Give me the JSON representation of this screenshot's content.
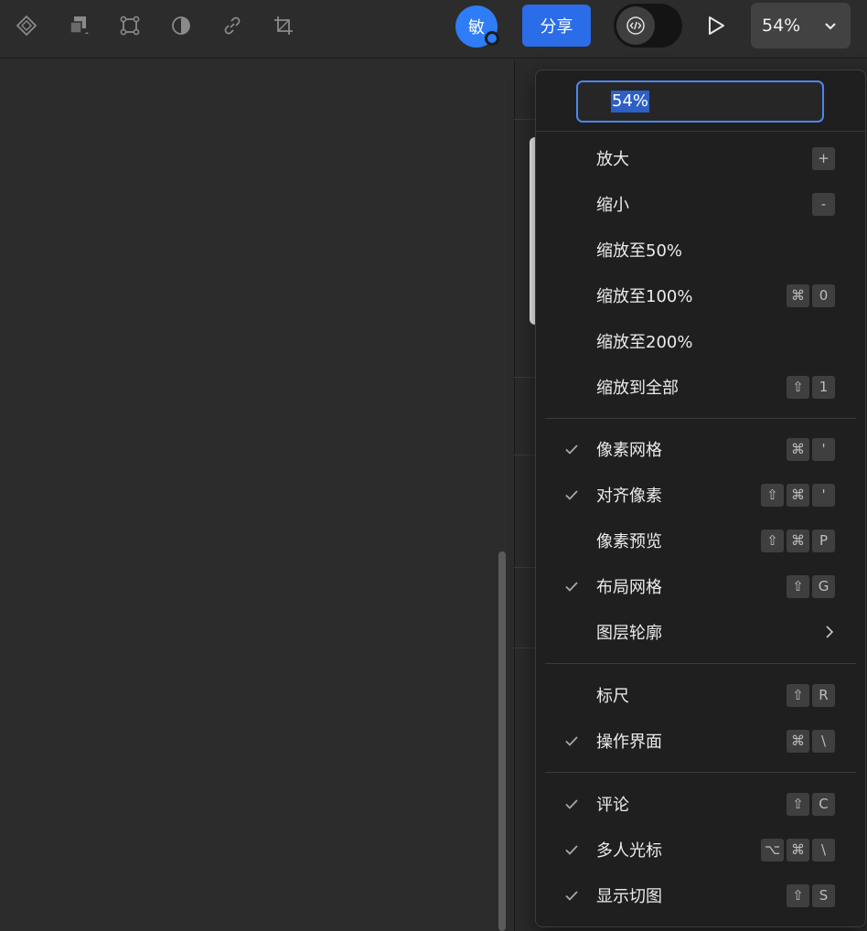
{
  "toolbar": {
    "tools": [
      {
        "name": "component-icon"
      },
      {
        "name": "boolean-icon"
      },
      {
        "name": "frame-select-icon"
      },
      {
        "name": "mask-icon"
      },
      {
        "name": "link-icon"
      },
      {
        "name": "crop-icon"
      }
    ],
    "avatar_text": "敏",
    "share_label": "分享",
    "dev_mode_icon": "code-icon",
    "zoom_value": "54%"
  },
  "zoom_menu": {
    "input_value": "54%",
    "groups": [
      {
        "items": [
          {
            "label": "放大",
            "checked": false,
            "keys": [
              "+"
            ]
          },
          {
            "label": "缩小",
            "checked": false,
            "keys": [
              "-"
            ]
          },
          {
            "label": "缩放至50%",
            "checked": false,
            "keys": []
          },
          {
            "label": "缩放至100%",
            "checked": false,
            "keys": [
              "⌘",
              "0"
            ]
          },
          {
            "label": "缩放至200%",
            "checked": false,
            "keys": []
          },
          {
            "label": "缩放到全部",
            "checked": false,
            "keys": [
              "⇧",
              "1"
            ]
          }
        ]
      },
      {
        "items": [
          {
            "label": "像素网格",
            "checked": true,
            "keys": [
              "⌘",
              "'"
            ]
          },
          {
            "label": "对齐像素",
            "checked": true,
            "keys": [
              "⇧",
              "⌘",
              "'"
            ]
          },
          {
            "label": "像素预览",
            "checked": false,
            "keys": [
              "⇧",
              "⌘",
              "P"
            ]
          },
          {
            "label": "布局网格",
            "checked": true,
            "keys": [
              "⇧",
              "G"
            ]
          },
          {
            "label": "图层轮廓",
            "checked": false,
            "keys": [],
            "submenu": true
          }
        ]
      },
      {
        "items": [
          {
            "label": "标尺",
            "checked": false,
            "keys": [
              "⇧",
              "R"
            ]
          },
          {
            "label": "操作界面",
            "checked": true,
            "keys": [
              "⌘",
              "\\"
            ]
          }
        ]
      },
      {
        "items": [
          {
            "label": "评论",
            "checked": true,
            "keys": [
              "⇧",
              "C"
            ]
          },
          {
            "label": "多人光标",
            "checked": true,
            "keys": [
              "⌥",
              "⌘",
              "\\"
            ]
          },
          {
            "label": "显示切图",
            "checked": true,
            "keys": [
              "⇧",
              "S"
            ]
          }
        ]
      }
    ]
  },
  "colors": {
    "accent": "#2b6de8",
    "background": "#2c2c2c",
    "menu_bg": "#1f1f1f"
  }
}
